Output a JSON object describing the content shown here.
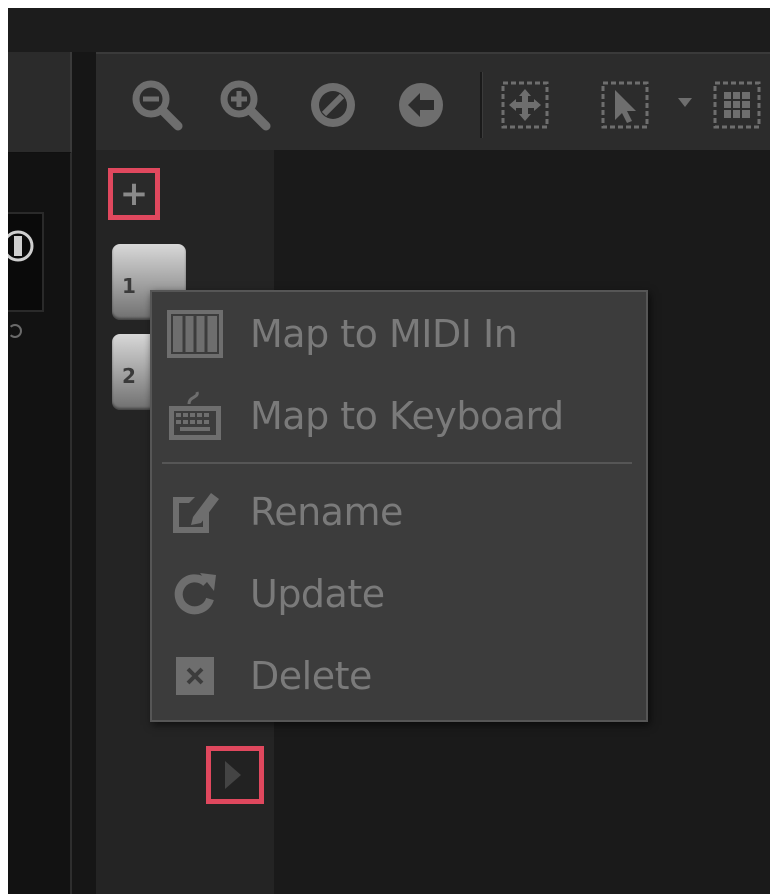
{
  "context_menu": {
    "items": [
      {
        "label": "Map to MIDI In",
        "icon": "piano-keys-icon"
      },
      {
        "label": "Map to Keyboard",
        "icon": "keyboard-icon"
      },
      {
        "label": "Rename",
        "icon": "edit-icon"
      },
      {
        "label": "Update",
        "icon": "refresh-icon"
      },
      {
        "label": "Delete",
        "icon": "delete-icon"
      }
    ]
  },
  "track": {
    "add_label": "+",
    "pads": [
      {
        "label": "1"
      },
      {
        "label": "2"
      }
    ]
  },
  "toolbar": {
    "icons": [
      "zoom-out-icon",
      "zoom-in-icon",
      "zoom-fit-icon",
      "back-icon",
      "move-select-icon",
      "pointer-select-icon",
      "grid-select-icon"
    ]
  },
  "colors": {
    "highlight": "#e0485e",
    "menu_bg": "#3c3c3c",
    "menu_text": "#7a7a7a",
    "icon_grey": "#6e6e6e"
  }
}
